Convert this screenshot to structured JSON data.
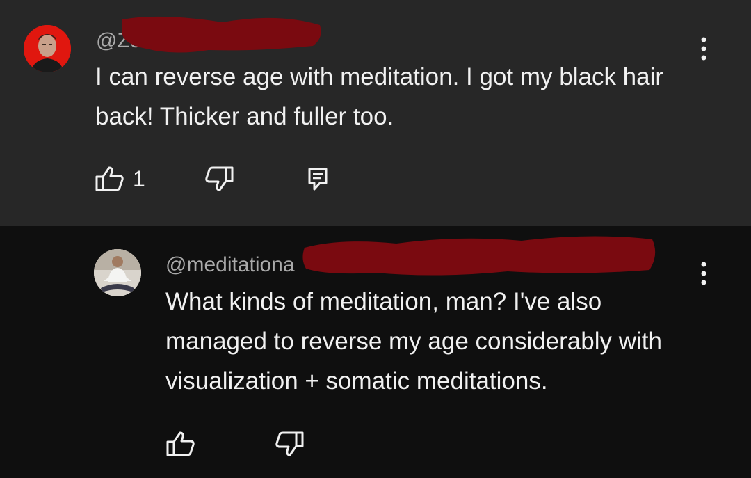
{
  "comments": [
    {
      "handle": "@Zolo",
      "text": "I can reverse age with meditation. I got my black hair back! Thicker and fuller too.",
      "like_count": "1",
      "icons": [
        "like-icon",
        "dislike-icon",
        "reply-icon",
        "more-vert-icon"
      ]
    },
    {
      "handle": "@meditationa",
      "text": "What kinds of meditation, man? I've also managed to reverse my age considerably with visualization + somatic meditations.",
      "icons": [
        "like-icon",
        "dislike-icon",
        "more-vert-icon"
      ]
    }
  ],
  "colors": {
    "top_bg": "#272727",
    "reply_bg": "#0f0f0f",
    "redaction": "#7a0a10",
    "text": "#f1f1f1",
    "secondary_text": "#aaaaaa"
  }
}
